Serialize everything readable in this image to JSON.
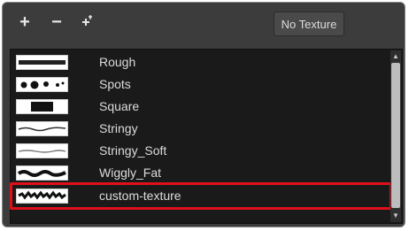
{
  "toolbar": {
    "add_glyph": "+",
    "remove_glyph": "−",
    "clone_glyph": "+",
    "no_texture_label": "No Texture"
  },
  "textures": [
    {
      "label": "Rough"
    },
    {
      "label": "Spots"
    },
    {
      "label": "Square"
    },
    {
      "label": "Stringy"
    },
    {
      "label": "Stringy_Soft"
    },
    {
      "label": "Wiggly_Fat"
    },
    {
      "label": "custom-texture"
    }
  ],
  "selection": {
    "selected_label": "custom-texture",
    "highlight_color": "#e0101b"
  },
  "icons": {
    "add": "plus-icon",
    "remove": "minus-icon",
    "clone": "clone-icon",
    "scroll_up": "chevron-up-icon",
    "scroll_down": "chevron-down-icon"
  }
}
